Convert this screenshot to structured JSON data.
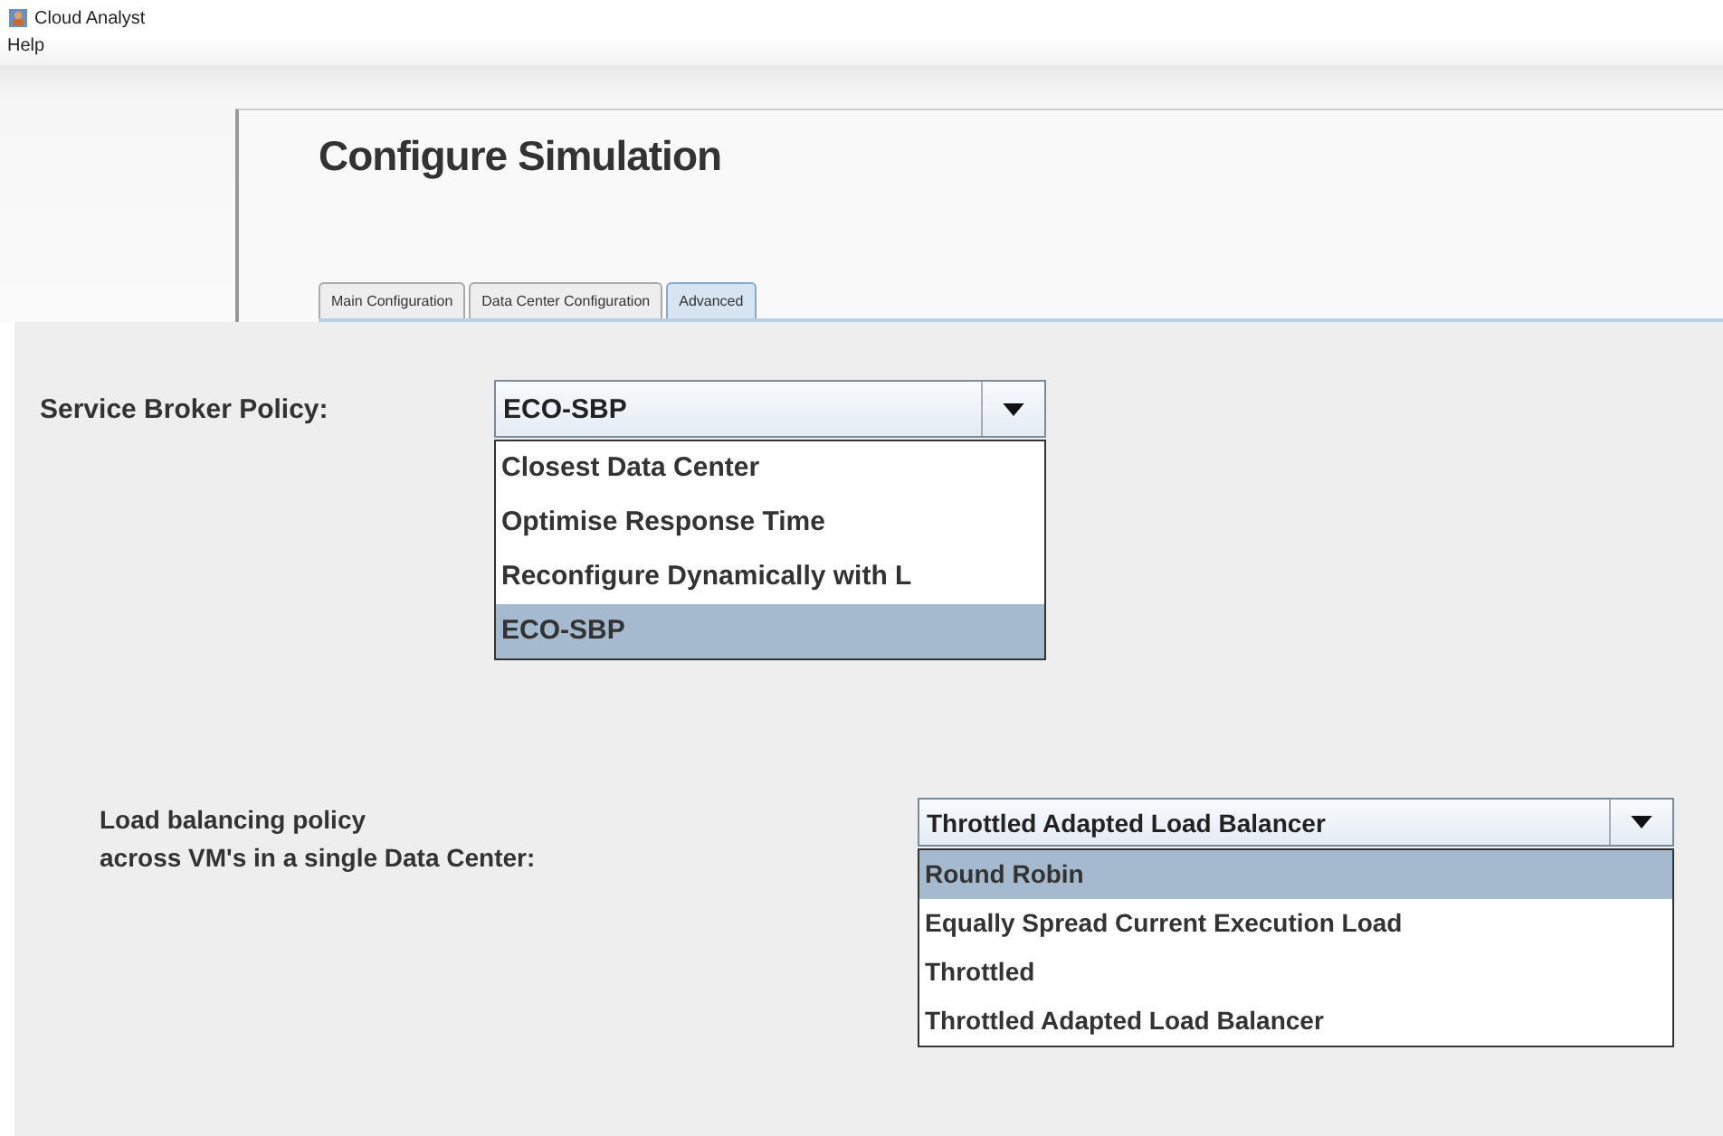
{
  "window": {
    "title": "Cloud Analyst"
  },
  "menu": [
    {
      "label": "Help"
    }
  ],
  "page_title": "Configure Simulation",
  "tabs": [
    {
      "label": "Main Configuration",
      "selected": false
    },
    {
      "label": "Data Center Configuration",
      "selected": false
    },
    {
      "label": "Advanced",
      "selected": true
    }
  ],
  "settings": [
    {
      "label": "Service Broker Policy:",
      "value": "ECO-SBP",
      "options": [
        {
          "label": "Closest Data Center",
          "highlighted": false
        },
        {
          "label": "Optimise Response Time",
          "highlighted": false
        },
        {
          "label": "Reconfigure Dynamically with L",
          "highlighted": false
        },
        {
          "label": "ECO-SBP",
          "highlighted": true
        }
      ]
    },
    {
      "label": "Load balancing policy\nacross VM's in a single Data Center:",
      "value": "Throttled Adapted Load Balancer",
      "options": [
        {
          "label": "Round Robin",
          "highlighted": true
        },
        {
          "label": "Equally Spread Current Execution Load",
          "highlighted": false
        },
        {
          "label": "Throttled",
          "highlighted": false
        },
        {
          "label": "Throttled Adapted Load Balancer",
          "highlighted": false
        }
      ]
    }
  ]
}
